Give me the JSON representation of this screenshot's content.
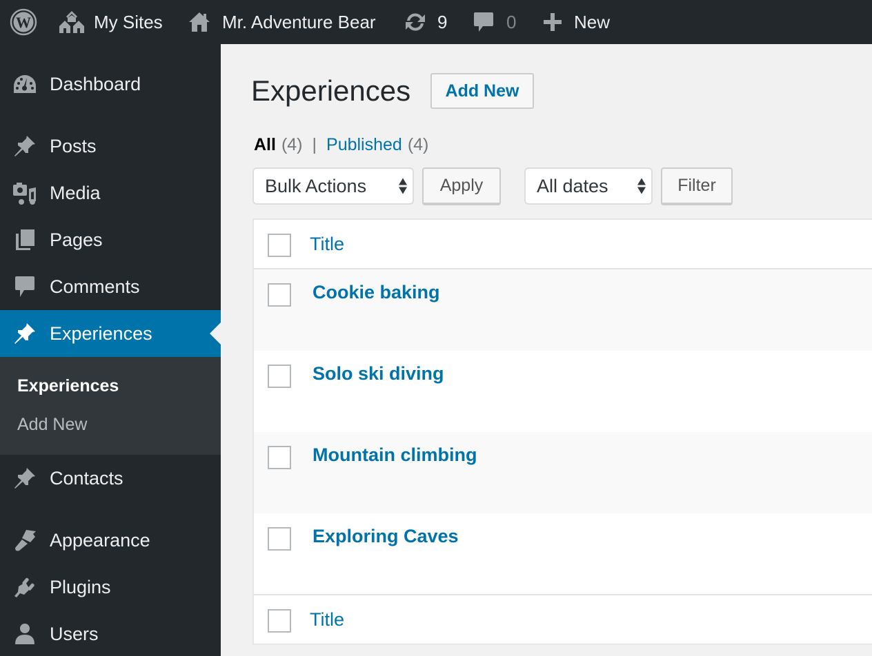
{
  "adminbar": {
    "my_sites": "My Sites",
    "site_name": "Mr. Adventure Bear",
    "updates_count": "9",
    "comments_count": "0",
    "new_label": "New"
  },
  "sidebar": {
    "items": [
      {
        "label": "Dashboard",
        "icon": "dashboard-icon"
      },
      {
        "label": "Posts",
        "icon": "pin-icon"
      },
      {
        "label": "Media",
        "icon": "media-icon"
      },
      {
        "label": "Pages",
        "icon": "pages-icon"
      },
      {
        "label": "Comments",
        "icon": "comment-icon"
      },
      {
        "label": "Experiences",
        "icon": "pin-icon",
        "active": true
      },
      {
        "label": "Contacts",
        "icon": "pin-icon"
      },
      {
        "label": "Appearance",
        "icon": "brush-icon"
      },
      {
        "label": "Plugins",
        "icon": "plugin-icon"
      },
      {
        "label": "Users",
        "icon": "user-icon"
      }
    ],
    "submenu": [
      {
        "label": "Experiences",
        "current": true
      },
      {
        "label": "Add New",
        "current": false
      }
    ]
  },
  "main": {
    "title": "Experiences",
    "add_new": "Add New",
    "views": {
      "all_label": "All",
      "all_count": "(4)",
      "separator": "|",
      "published_label": "Published",
      "published_count": "(4)"
    },
    "bulk_actions": "Bulk Actions",
    "apply": "Apply",
    "date_filter": "All dates",
    "filter": "Filter",
    "table": {
      "column_title": "Title",
      "rows": [
        {
          "title": "Cookie baking"
        },
        {
          "title": "Solo ski diving"
        },
        {
          "title": "Mountain climbing"
        },
        {
          "title": "Exploring Caves"
        }
      ]
    }
  },
  "colors": {
    "adminbar_bg": "#23282d",
    "accent": "#0073aa",
    "submenu_bg": "#32373c",
    "content_bg": "#f1f1f1"
  }
}
